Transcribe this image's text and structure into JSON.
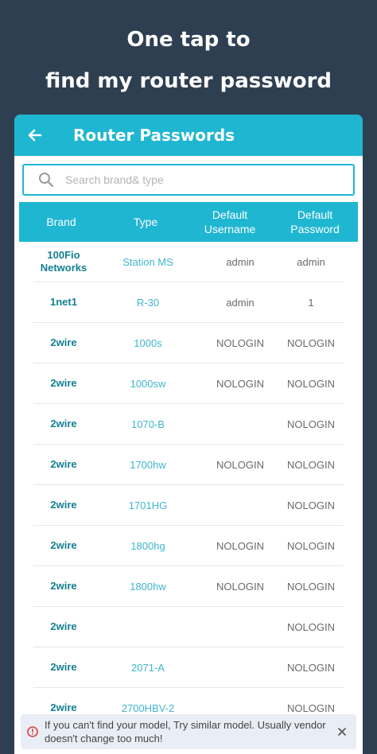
{
  "promo": {
    "line1": "One tap to",
    "line2": "find my router password"
  },
  "appbar": {
    "title": "Router Passwords",
    "back_icon": "arrow-left-icon"
  },
  "search": {
    "placeholder": "Search brand& type",
    "value": "",
    "icon": "search-icon"
  },
  "table": {
    "headers": {
      "brand": "Brand",
      "type": "Type",
      "username": "Default Username",
      "password": "Default Password"
    },
    "rows": [
      {
        "brand": "100Fio Networks",
        "type": "Station MS",
        "username": "admin",
        "password": "admin"
      },
      {
        "brand": "1net1",
        "type": "R-30",
        "username": "admin",
        "password": "1"
      },
      {
        "brand": "2wire",
        "type": "1000s",
        "username": "NOLOGIN",
        "password": "NOLOGIN"
      },
      {
        "brand": "2wire",
        "type": "1000sw",
        "username": "NOLOGIN",
        "password": "NOLOGIN"
      },
      {
        "brand": "2wire",
        "type": "1070-B",
        "username": "",
        "password": "NOLOGIN"
      },
      {
        "brand": "2wire",
        "type": "1700hw",
        "username": "NOLOGIN",
        "password": "NOLOGIN"
      },
      {
        "brand": "2wire",
        "type": "1701HG",
        "username": "",
        "password": "NOLOGIN"
      },
      {
        "brand": "2wire",
        "type": "1800hg",
        "username": "NOLOGIN",
        "password": "NOLOGIN"
      },
      {
        "brand": "2wire",
        "type": "1800hw",
        "username": "NOLOGIN",
        "password": "NOLOGIN"
      },
      {
        "brand": "2wire",
        "type": "",
        "username": "",
        "password": "NOLOGIN"
      },
      {
        "brand": "2wire",
        "type": "2071-A",
        "username": "",
        "password": "NOLOGIN"
      },
      {
        "brand": "2wire",
        "type": "2700HBV-2",
        "username": "",
        "password": "NOLOGIN"
      }
    ]
  },
  "toast": {
    "text": "If you can't find your model, Try similar model. Usually vendor doesn't change too much!",
    "info_icon": "info-circle-icon",
    "close_icon": "close-icon"
  },
  "colors": {
    "background": "#2f3f52",
    "accent": "#1fb6d1",
    "brand_text": "#137f91",
    "type_text": "#3fb6cc",
    "toast_bg": "#e9edf5",
    "warning": "#d64545"
  }
}
